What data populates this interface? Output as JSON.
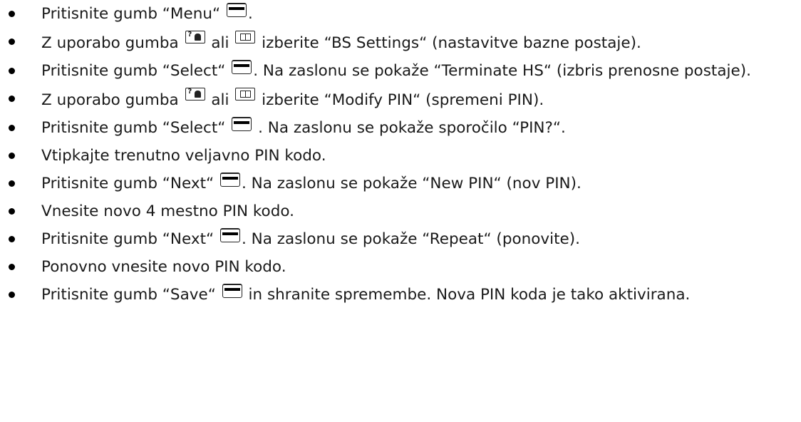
{
  "steps": [
    {
      "p1": "Pritisnite gumb “Menu“ ",
      "i1": "menu-key-icon",
      "p2": "."
    },
    {
      "p1": "Z uporabo gumba ",
      "i1": "up-key-icon",
      "p2": " ali ",
      "i2": "down-key-icon",
      "p3": " izberite “BS Settings“ (nastavitve bazne postaje)."
    },
    {
      "p1": "Pritisnite gumb “Select“ ",
      "i1": "menu-key-icon",
      "p2": ". Na zaslonu se pokaže “Terminate HS“ (izbris prenosne postaje)."
    },
    {
      "p1": "Z uporabo gumba ",
      "i1": "up-key-icon",
      "p2": " ali ",
      "i2": "down-key-icon",
      "p3": " izberite “Modify PIN“ (spremeni PIN)."
    },
    {
      "p1": "Pritisnite gumb “Select“ ",
      "i1": "menu-key-icon",
      "p2": " . Na zaslonu se pokaže sporočilo “PIN?“."
    },
    {
      "p1": "Vtipkajte trenutno veljavno PIN kodo."
    },
    {
      "p1": "Pritisnite gumb “Next“ ",
      "i1": "menu-key-icon",
      "p2": ". Na zaslonu se pokaže “New PIN“ (nov PIN)."
    },
    {
      "p1": "Vnesite novo 4 mestno PIN kodo."
    },
    {
      "p1": "Pritisnite gumb “Next“ ",
      "i1": "menu-key-icon",
      "p2": ". Na zaslonu se pokaže “Repeat“ (ponovite)."
    },
    {
      "p1": "Ponovno vnesite novo PIN kodo."
    },
    {
      "p1": "Pritisnite gumb “Save“ ",
      "i1": "menu-key-icon",
      "p2": " in shranite spremembe. Nova PIN koda je tako aktivirana."
    }
  ]
}
